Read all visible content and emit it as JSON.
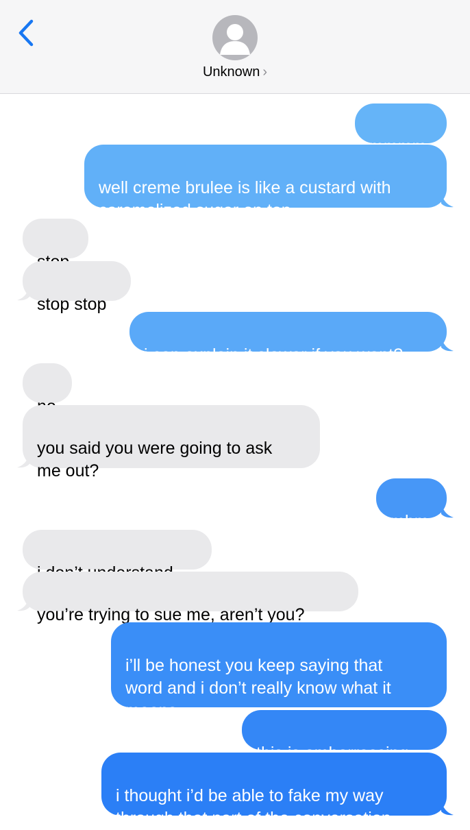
{
  "header": {
    "contact_name": "Unknown",
    "chevron": "›"
  },
  "colors": {
    "incoming_bubble": "#e9e9eb",
    "outgoing_top": "#65b4f8",
    "outgoing_bottom": "#2b7ff6",
    "back_arrow": "#1877f2"
  },
  "messages": [
    {
      "sender": "me",
      "text": "mmmm"
    },
    {
      "sender": "me",
      "text": "well creme brulee is like a custard with\ncaramelized sugar on top"
    },
    {
      "sender": "them",
      "text": "stop"
    },
    {
      "sender": "them",
      "text": "stop stop"
    },
    {
      "sender": "me",
      "text": "i can explain it slower if you want?"
    },
    {
      "sender": "them",
      "text": "no"
    },
    {
      "sender": "them",
      "text": "you said you were going to ask\nme out?"
    },
    {
      "sender": "me",
      "text": "mhm"
    },
    {
      "sender": "them",
      "text": "i don’t understand"
    },
    {
      "sender": "them",
      "text": "you’re trying to sue me, aren’t you?"
    },
    {
      "sender": "me",
      "text": "i’ll be honest you keep saying that\nword and i don’t really know what it\nmeans"
    },
    {
      "sender": "me",
      "text": "this is embarrassing"
    },
    {
      "sender": "me",
      "text": "i thought i’d be able to fake my way\nthrough that part of the conversation"
    }
  ]
}
